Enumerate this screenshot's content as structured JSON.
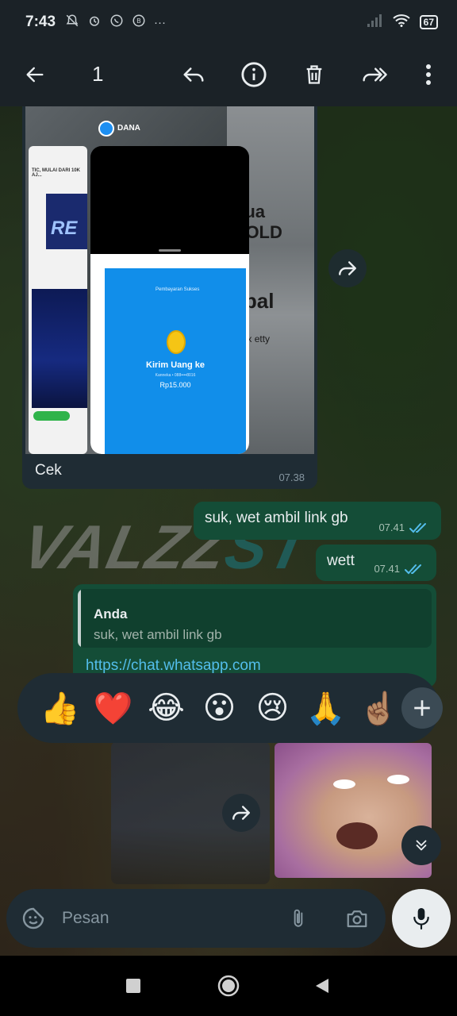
{
  "status_bar": {
    "time": "7:43",
    "left_icons": [
      "mute-icon",
      "alarm-icon",
      "whatsapp-icon",
      "b-badge-icon"
    ],
    "more": "···",
    "battery": "67"
  },
  "toolbar": {
    "selected_count": "1",
    "icons": [
      "back-arrow-icon",
      "reply-icon",
      "info-icon",
      "delete-icon",
      "forward-icon",
      "more-vert-icon"
    ]
  },
  "messages": {
    "image_message": {
      "caption": "Cek",
      "time": "07.38",
      "image_text": {
        "dana_label": "DANA",
        "left_card_text": "RE",
        "left_card_tiny": "TIC, MULAI DARI 10K AJ...",
        "pay_header_small": "Pembayaran Sukses",
        "pay_title": "Kirim Uang ke",
        "pay_subtitle": "Kanneka • 088••••8016",
        "pay_amount": "Rp15.000",
        "anime_text_1": "illua",
        "anime_text_2": "ZOLD",
        "anime_text_3": "- bal",
        "anime_text_4": "anelix  etty"
      }
    },
    "outgoing_1": {
      "text": "suk, wet ambil link gb",
      "time": "07.41"
    },
    "outgoing_2": {
      "text": "wett",
      "time": "07.41"
    },
    "reply_message": {
      "quote_author": "Anda",
      "quote_text": "suk, wet ambil link gb",
      "link": "https://chat.whatsapp.com"
    }
  },
  "reactions": {
    "emojis": [
      "👍",
      "❤️",
      "😂",
      "😮",
      "😢",
      "🙏",
      "☝🏽"
    ],
    "plus_icon": "plus-icon"
  },
  "background": {
    "watermark_main": "VALZZ",
    "watermark_accent": "ST"
  },
  "input": {
    "placeholder": "Pesan",
    "icons": [
      "sticker-icon",
      "attach-icon",
      "camera-icon",
      "mic-icon"
    ]
  },
  "colors": {
    "outgoing_bubble": "#144d37",
    "incoming_bubble": "#1f2c34",
    "link": "#53bdeb",
    "read_ticks": "#53bdeb"
  }
}
